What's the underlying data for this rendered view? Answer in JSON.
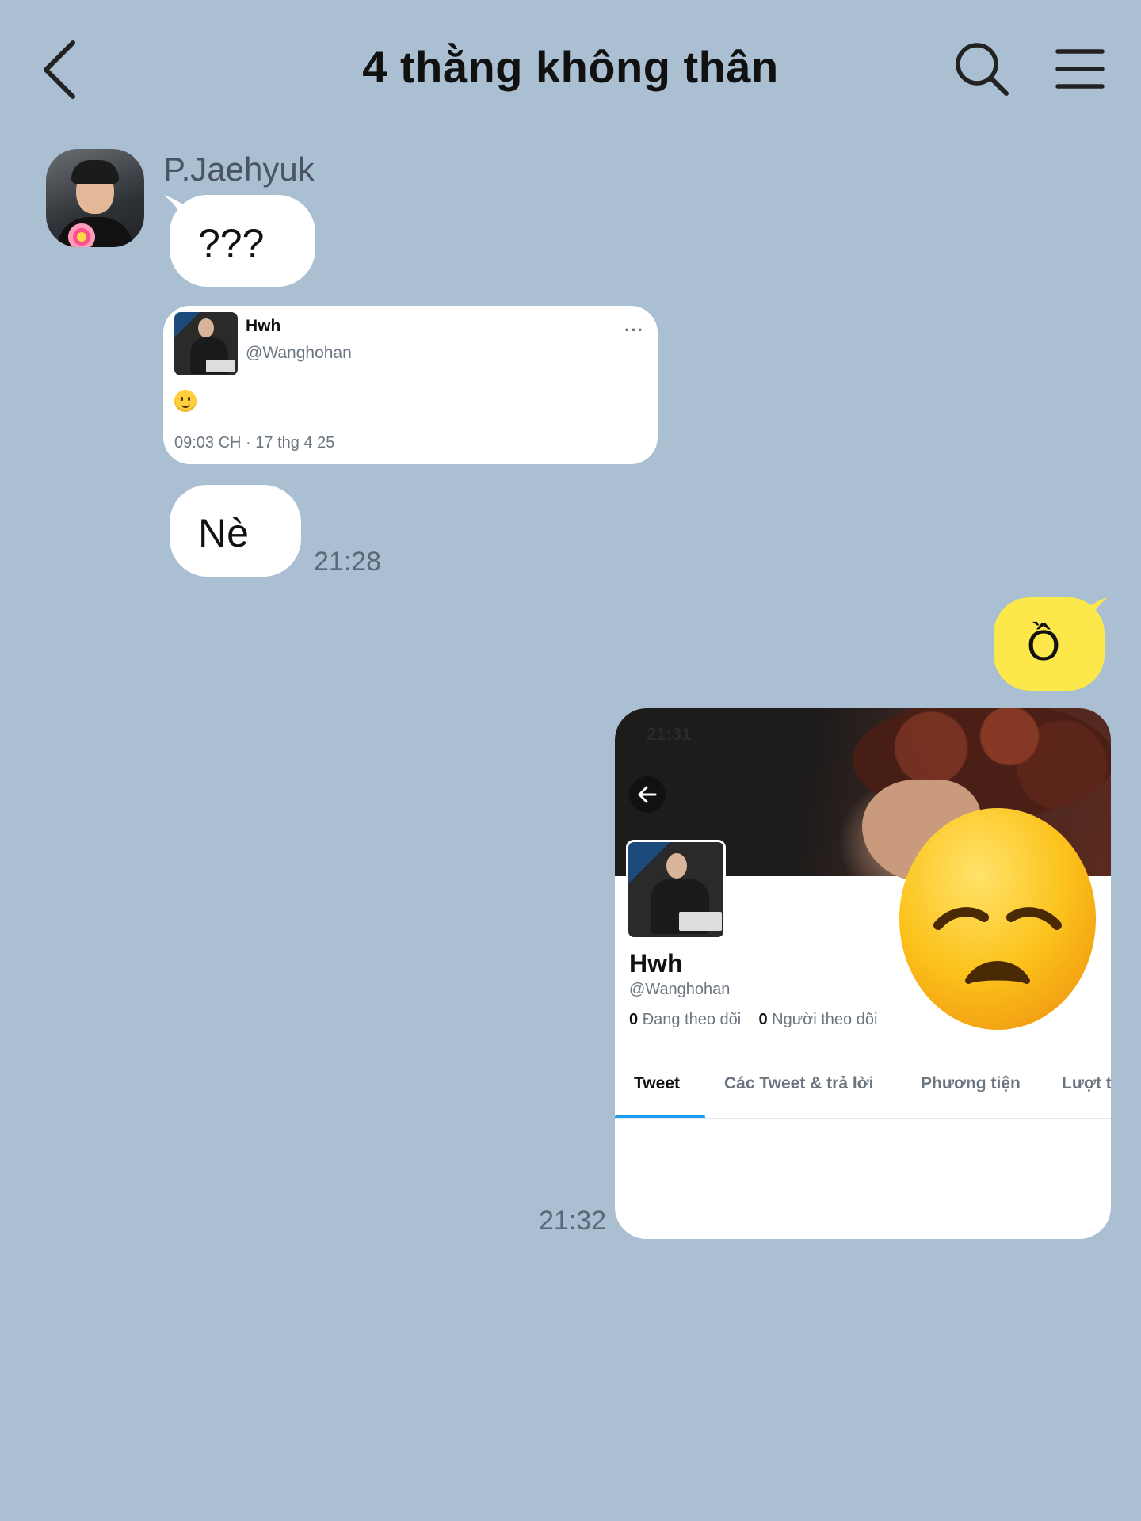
{
  "header": {
    "title": "4 thằng không thân",
    "back_icon": "chevron-left-icon",
    "search_icon": "search-icon",
    "menu_icon": "hamburger-menu-icon"
  },
  "colors": {
    "background": "#abbfd3",
    "incoming_bubble": "#ffffff",
    "outgoing_bubble": "#fce84a",
    "tab_accent": "#1d9bf0"
  },
  "messages": {
    "sender_name": "P.Jaehyuk",
    "m1_text": "???",
    "tweet": {
      "name": "Hwh",
      "handle": "@Wanghohan",
      "more": "···",
      "emoji": "slightly-smiling-face",
      "timestamp": "09:03 CH · 17 thg 4 25"
    },
    "m3_text": "Nè",
    "m3_time": "21:28",
    "reply_text": "Ồ",
    "screenshot": {
      "status_time": "21:31",
      "name": "Hwh",
      "handle": "@Wanghohan",
      "following_count": "0",
      "following_label": "Đang theo dõi",
      "followers_count": "0",
      "followers_label": "Người theo dõi",
      "tabs": [
        "Tweet",
        "Các Tweet & trả lời",
        "Phương tiện",
        "Lượt t"
      ],
      "active_tab": "Tweet"
    },
    "sticker": "disappointed-face",
    "screenshot_time": "21:32"
  }
}
